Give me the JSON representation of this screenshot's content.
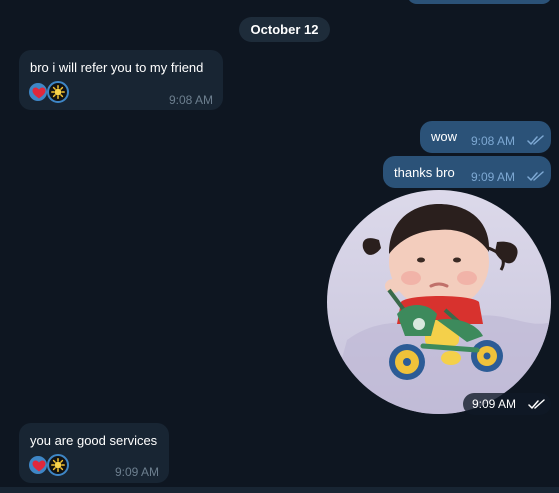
{
  "date_separator": "October 12",
  "messages": [
    {
      "text": "bro i will refer you to my friend",
      "time": "9:08 AM"
    },
    {
      "text": "wow",
      "time": "9:08 AM"
    },
    {
      "text": "thanks bro",
      "time": "9:09 AM"
    },
    {
      "text": "you are good services",
      "time": "9:09 AM"
    }
  ],
  "sticker": {
    "time": "9:09 AM"
  },
  "icons": {
    "reaction_1": "red-heart-icon",
    "reaction_2": "sun-sticker-icon",
    "read_receipt": "double-check-icon"
  },
  "colors": {
    "background": "#0e1621",
    "incoming_bubble": "#182533",
    "outgoing_bubble": "#2b5278",
    "reaction_accent": "#3e86c6",
    "heart": "#e0283c"
  }
}
